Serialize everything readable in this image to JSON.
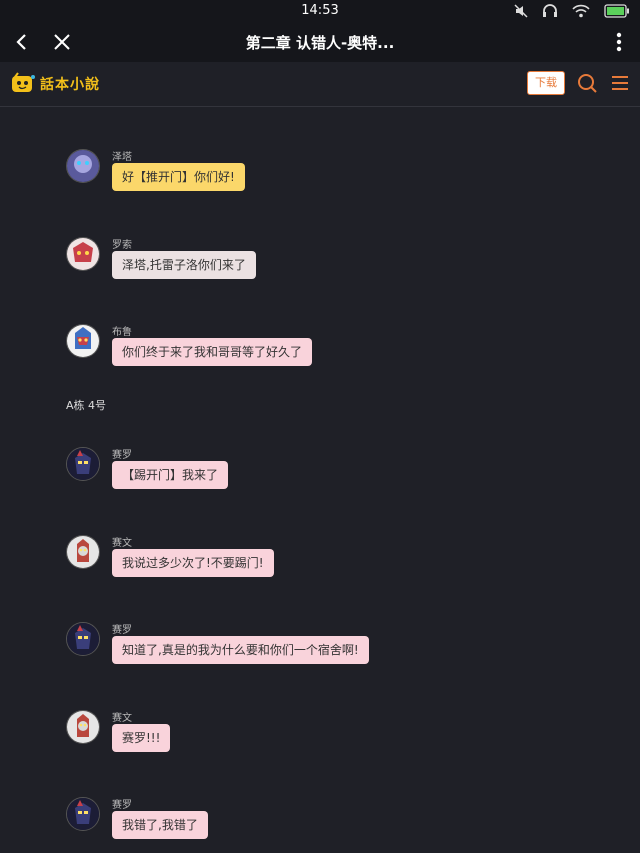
{
  "status_bar": {
    "time": "14:53"
  },
  "title_bar": {
    "title": "第二章 认错人-奥特..."
  },
  "header": {
    "logo_text": "話本小說",
    "download_label": "下载"
  },
  "messages": [
    {
      "name": "泽塔",
      "text": "好【推开门】你们好!",
      "bubble": "yellow",
      "avatar_color": "#6d64b8"
    },
    {
      "name": "罗索",
      "text": "泽塔,托雷子洛你们来了",
      "bubble": "grey",
      "avatar_color": "#c7404a"
    },
    {
      "name": "布鲁",
      "text": "你们终于来了我和哥哥等了好久了",
      "bubble": "pink",
      "avatar_color": "#3f6fc2"
    }
  ],
  "scene": "A栋 4号",
  "messages2": [
    {
      "name": "赛罗",
      "text": "【踢开门】我来了",
      "bubble": "pink",
      "avatar_color": "#2b2f5a"
    },
    {
      "name": "赛文",
      "text": "我说过多少次了!不要踢门!",
      "bubble": "pink",
      "avatar_color": "#b9473d"
    },
    {
      "name": "赛罗",
      "text": "知道了,真是的我为什么要和你们一个宿舍啊!",
      "bubble": "pink",
      "avatar_color": "#2b2f5a"
    },
    {
      "name": "赛文",
      "text": "赛罗!!!",
      "bubble": "pink",
      "avatar_color": "#b9473d"
    },
    {
      "name": "赛罗",
      "text": "我错了,我错了",
      "bubble": "pink",
      "avatar_color": "#2b2f5a"
    }
  ],
  "colors": {
    "bubble_yellow": "#fbd76a",
    "bubble_pink": "#f9d3db",
    "bubble_grey": "#ebe1e2",
    "accent": "#e77a3a"
  }
}
